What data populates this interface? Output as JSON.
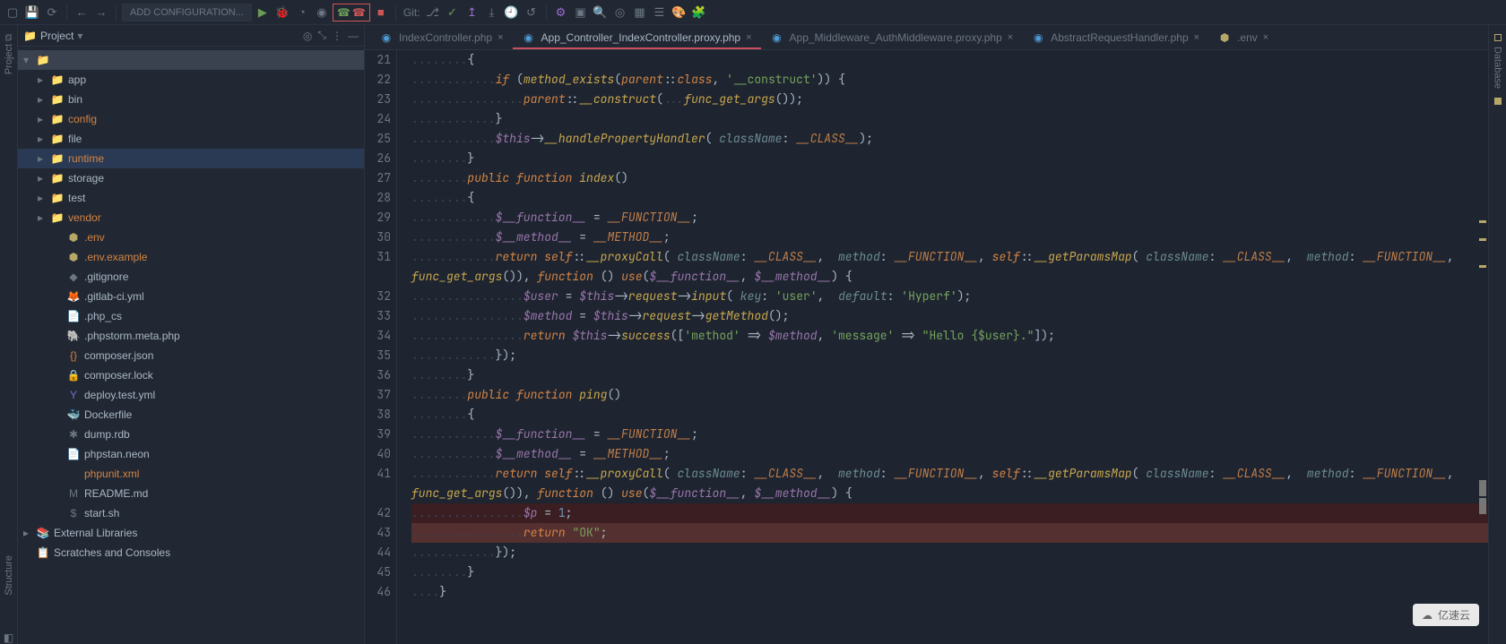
{
  "toolbar": {
    "run_config": "ADD CONFIGURATION...",
    "git_label": "Git:"
  },
  "leftbar": {
    "project": "Project",
    "structure": "Structure"
  },
  "rightbar": {
    "database": "Database"
  },
  "project": {
    "title": "Project",
    "root": {
      "name": "",
      "hint": ""
    },
    "folders": [
      {
        "name": "app",
        "color": "text"
      },
      {
        "name": "bin",
        "color": "text"
      },
      {
        "name": "config",
        "color": "orange"
      },
      {
        "name": "file",
        "color": "text"
      },
      {
        "name": "runtime",
        "color": "orange",
        "active": true
      },
      {
        "name": "storage",
        "color": "text"
      },
      {
        "name": "test",
        "color": "text"
      },
      {
        "name": "vendor",
        "color": "orange"
      }
    ],
    "files": [
      {
        "icon": "env",
        "name": ".env",
        "color": "orange"
      },
      {
        "icon": "env",
        "name": ".env.example",
        "color": "orange"
      },
      {
        "icon": "gitignore",
        "name": ".gitignore",
        "color": "text"
      },
      {
        "icon": "gitlab",
        "name": ".gitlab-ci.yml",
        "color": "text"
      },
      {
        "icon": "file",
        "name": ".php_cs",
        "color": "text"
      },
      {
        "icon": "php",
        "name": ".phpstorm.meta.php",
        "color": "text"
      },
      {
        "icon": "json",
        "name": "composer.json",
        "color": "text"
      },
      {
        "icon": "lock",
        "name": "composer.lock",
        "color": "text"
      },
      {
        "icon": "yml",
        "name": "deploy.test.yml",
        "color": "text"
      },
      {
        "icon": "docker",
        "name": "Dockerfile",
        "color": "text"
      },
      {
        "icon": "db",
        "name": "dump.rdb",
        "color": "text"
      },
      {
        "icon": "file",
        "name": "phpstan.neon",
        "color": "text"
      },
      {
        "icon": "xml",
        "name": "phpunit.xml",
        "color": "orange"
      },
      {
        "icon": "md",
        "name": "README.md",
        "color": "text"
      },
      {
        "icon": "sh",
        "name": "start.sh",
        "color": "text"
      }
    ],
    "extra": [
      {
        "name": "External Libraries"
      },
      {
        "name": "Scratches and Consoles"
      }
    ]
  },
  "tabs": [
    {
      "name": "IndexController.php",
      "icon": "php",
      "active": false
    },
    {
      "name": "App_Controller_IndexController.proxy.php",
      "icon": "php",
      "active": true
    },
    {
      "name": "App_Middleware_AuthMiddleware.proxy.php",
      "icon": "php",
      "active": false
    },
    {
      "name": "AbstractRequestHandler.php",
      "icon": "php",
      "active": false
    },
    {
      "name": ".env",
      "icon": "env",
      "active": false
    }
  ],
  "editor": {
    "first_line": 21,
    "lines": [
      "........{",
      "............if (method_exists(parent::class, '__construct')) {",
      "................parent::__construct(...func_get_args());",
      "............}",
      "............$this->__handlePropertyHandler( className: __CLASS__);",
      "........}",
      "........public function index()",
      "........{",
      "............$__function__ = __FUNCTION__;",
      "............$__method__ = __METHOD__;",
      "............return self::__proxyCall( className: __CLASS__,  method: __FUNCTION__, self::__getParamsMap( className: __CLASS__,  method: __FUNCTION__, ",
      "func_get_args()), function () use($__function__, $__method__) {",
      "................$user = $this->request->input( key: 'user',  default: 'Hyperf');",
      "................$method = $this->request->getMethod();",
      "................return $this->success(['method' => $method, 'message' => \"Hello {$user}.\"]);",
      "............});",
      "........}",
      "........public function ping()",
      "........{",
      "............$__function__ = __FUNCTION__;",
      "............$__method__ = __METHOD__;",
      "............return self::__proxyCall( className: __CLASS__,  method: __FUNCTION__, self::__getParamsMap( className: __CLASS__,  method: __FUNCTION__, ",
      "func_get_args()), function () use($__function__, $__method__) {",
      "................$p = 1;",
      "................return \"OK\";",
      "............});",
      "........}",
      "....}"
    ],
    "highlight_rows": [
      42,
      43
    ],
    "strong_highlight_rows": [
      43
    ]
  },
  "watermark": "亿速云"
}
